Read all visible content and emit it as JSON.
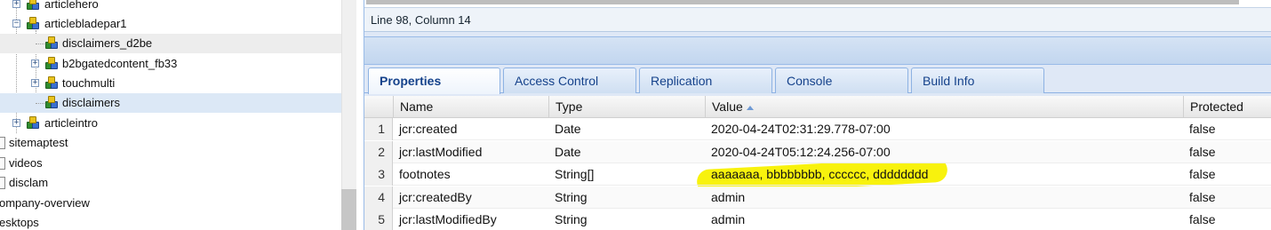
{
  "tree": {
    "items": [
      {
        "label": "articlehero"
      },
      {
        "label": "articlebladepar1"
      },
      {
        "label": "disclaimers_d2be"
      },
      {
        "label": "b2bgatedcontent_fb33"
      },
      {
        "label": "touchmulti"
      },
      {
        "label": "disclaimers"
      },
      {
        "label": "articleintro"
      },
      {
        "label": "sitemaptest"
      },
      {
        "label": "videos"
      },
      {
        "label": "disclam"
      },
      {
        "label": "ompany-overview"
      },
      {
        "label": "esktops"
      }
    ]
  },
  "editor": {
    "status": "Line 98, Column 14"
  },
  "tabs": [
    {
      "label": "Properties",
      "active": true
    },
    {
      "label": "Access Control"
    },
    {
      "label": "Replication"
    },
    {
      "label": "Console"
    },
    {
      "label": "Build Info"
    }
  ],
  "grid": {
    "columns": [
      "Name",
      "Type",
      "Value",
      "Protected"
    ],
    "sort_column": "Value",
    "rows": [
      {
        "num": "1",
        "name": "jcr:created",
        "type": "Date",
        "value": "2020-04-24T02:31:29.778-07:00",
        "protected": "false"
      },
      {
        "num": "2",
        "name": "jcr:lastModified",
        "type": "Date",
        "value": "2020-04-24T05:12:24.256-07:00",
        "protected": "false"
      },
      {
        "num": "3",
        "name": "footnotes",
        "type": "String[]",
        "value": "aaaaaaa, bbbbbbbb, cccccc, dddddddd",
        "protected": "false"
      },
      {
        "num": "4",
        "name": "jcr:createdBy",
        "type": "String",
        "value": "admin",
        "protected": "false"
      },
      {
        "num": "5",
        "name": "jcr:lastModifiedBy",
        "type": "String",
        "value": "admin",
        "protected": "false"
      }
    ]
  },
  "colors": {
    "accent": "#15428b",
    "highlight": "#f8f100",
    "selected_row": "#dce8f6"
  }
}
